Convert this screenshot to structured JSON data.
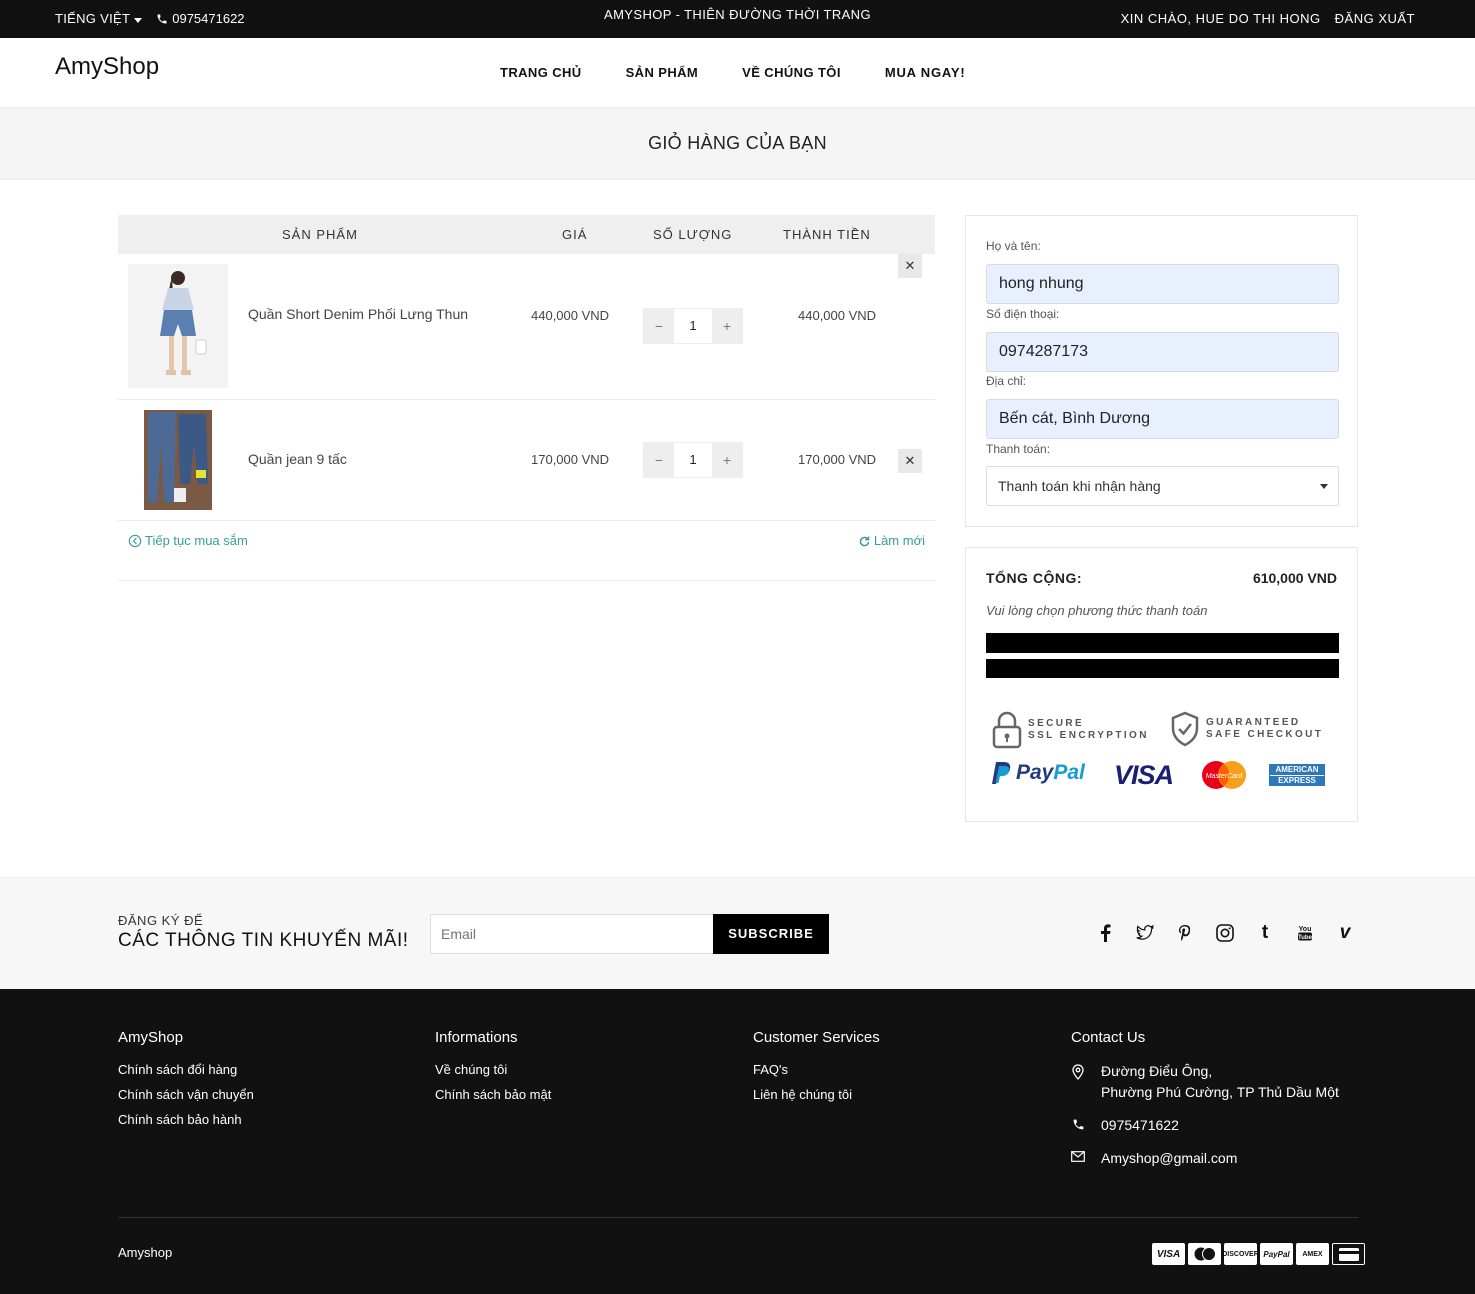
{
  "topbar": {
    "language": "TIẾNG VIỆT",
    "phone": "0975471622",
    "tagline": "AMYSHOP - THIÊN ĐƯỜNG THỜI TRANG",
    "greeting": "XIN CHÀO, HUE DO THI HONG",
    "logout": "ĐĂNG XUẤT"
  },
  "header": {
    "logo": "AmyShop",
    "nav": [
      "TRANG CHỦ",
      "SẢN PHẨM",
      "VỀ CHÚNG TÔI",
      "MUA NGAY!"
    ]
  },
  "page_title": "GIỎ HÀNG CỦA BẠN",
  "cart": {
    "columns": [
      "SẢN PHẨM",
      "GIÁ",
      "SỐ LƯỢNG",
      "THÀNH TIỀN"
    ],
    "items": [
      {
        "name": "Quần Short Denim Phối Lưng Thun",
        "price": "440,000 VND",
        "qty": "1",
        "total": "440,000 VND"
      },
      {
        "name": "Quần jean 9 tấc",
        "price": "170,000 VND",
        "qty": "1",
        "total": "170,000 VND"
      }
    ],
    "continue_label": "Tiếp tục mua sắm",
    "refresh_label": "Làm mới"
  },
  "checkout_form": {
    "name_label": "Họ và tên:",
    "name_value": "hong nhung",
    "phone_label": "Số điện thoại:",
    "phone_value": "0974287173",
    "address_label": "Địa chỉ:",
    "address_value": "Bến cát, Bình Dương",
    "payment_label": "Thanh toán:",
    "payment_value": "Thanh toán khi nhận hàng"
  },
  "summary": {
    "total_label": "TỔNG CỘNG:",
    "total_value": "610,000 VND",
    "note": "Vui lòng chọn phương thức thanh toán",
    "badge_secure_1": "SECURE",
    "badge_secure_2": "SSL ENCRYPTION",
    "badge_guarantee_1": "GUARANTEED",
    "badge_guarantee_2": "SAFE CHECKOUT",
    "pay_logos": [
      "PayPal",
      "VISA",
      "MasterCard",
      "AMERICAN EXPRESS"
    ]
  },
  "newsletter": {
    "small": "ĐĂNG KÝ ĐỂ",
    "big": "CÁC THÔNG TIN KHUYẾN MÃI!",
    "placeholder": "Email",
    "button": "SUBSCRIBE",
    "social_icons": [
      "facebook-icon",
      "twitter-icon",
      "pinterest-icon",
      "instagram-icon",
      "tumblr-icon",
      "youtube-icon",
      "vimeo-icon"
    ]
  },
  "footer": {
    "col1": {
      "title": "AmyShop",
      "links": [
        "Chính sách đổi hàng",
        "Chính sách vận chuyển",
        "Chính sách bảo hành"
      ]
    },
    "col2": {
      "title": "Informations",
      "links": [
        "Về chúng tôi",
        "Chính sách bảo mật"
      ]
    },
    "col3": {
      "title": "Customer Services",
      "links": [
        "FAQ's",
        "Liên hệ chúng tôi"
      ]
    },
    "col4": {
      "title": "Contact Us",
      "address_line1": "Đường Điểu Ông,",
      "address_line2": "Phường Phú Cường, TP Thủ Dầu Một",
      "phone": "0975471622",
      "email": "Amyshop@gmail.com"
    },
    "copyright": "Amyshop",
    "cards": [
      "VISA",
      "MC",
      "DISCOVER",
      "PayPal",
      "AMEX",
      "CARD"
    ]
  },
  "colors": {
    "accent": "#3a9aa0",
    "topbar": "#111111",
    "input_bg": "#e8f0fe"
  }
}
